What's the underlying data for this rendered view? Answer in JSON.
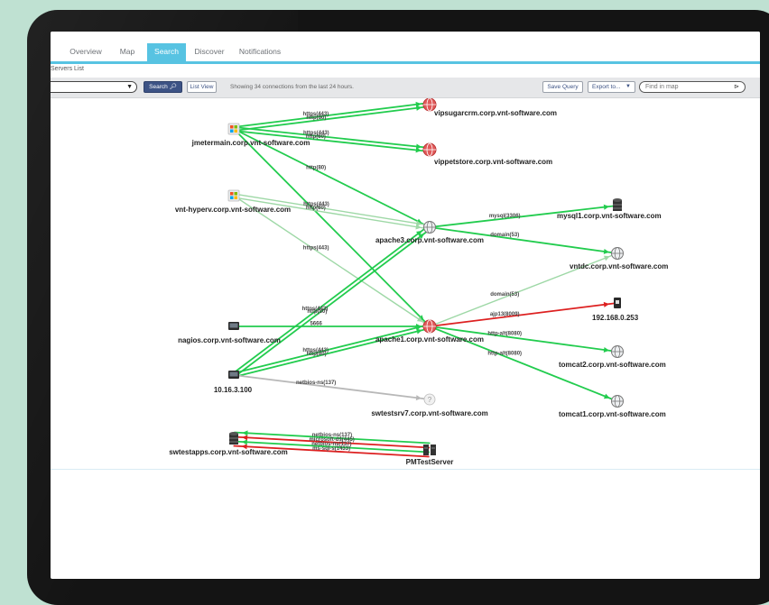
{
  "tabs": [
    {
      "label": "Overview"
    },
    {
      "label": "Map"
    },
    {
      "label": "Search"
    },
    {
      "label": "Discover"
    },
    {
      "label": "Notifications"
    }
  ],
  "breadcrumb": "Servers List",
  "toolbar": {
    "search_label": "Search",
    "list_view_label": "List View",
    "status_text": "Showing 34 connections from the last 24 hours.",
    "save_query_label": "Save Query",
    "export_label": "Export to...",
    "find_placeholder": "Find in map"
  },
  "colors": {
    "accent": "#57c3e2",
    "edge_green": "#22cc4e",
    "edge_light_green": "#9ed8a6",
    "edge_red": "#dd2020",
    "edge_gray": "#b8b8b8"
  },
  "nodes": [
    {
      "id": "jmeter",
      "label": "jmetermain.corp.vnt-software.com",
      "icon": "windows-server-icon"
    },
    {
      "id": "vipsugar",
      "label": "vipsugarcrm.corp.vnt-software.com",
      "icon": "red-globe-icon"
    },
    {
      "id": "vippet",
      "label": "vippetstore.corp.vnt-software.com",
      "icon": "red-globe-icon"
    },
    {
      "id": "hyperv",
      "label": "vnt-hyperv.corp.vnt-software.com",
      "icon": "windows-server-icon"
    },
    {
      "id": "apache3",
      "label": "apache3.corp.vnt-software.com",
      "icon": "web-server-icon"
    },
    {
      "id": "mysql1",
      "label": "mysql1.corp.vnt-software.com",
      "icon": "database-icon"
    },
    {
      "id": "vntdc",
      "label": "vntdc.corp.vnt-software.com",
      "icon": "globe-icon"
    },
    {
      "id": "ip253",
      "label": "192.168.0.253",
      "icon": "device-icon"
    },
    {
      "id": "nagios",
      "label": "nagios.corp.vnt-software.com",
      "icon": "monitor-icon"
    },
    {
      "id": "apache1",
      "label": "apache1.corp.vnt-software.com",
      "icon": "red-web-server-icon"
    },
    {
      "id": "tomcat2",
      "label": "tomcat2.corp.vnt-software.com",
      "icon": "globe-icon"
    },
    {
      "id": "ip100",
      "label": "10.16.3.100",
      "icon": "monitor-icon"
    },
    {
      "id": "swtestsrv7",
      "label": "swtestsrv7.corp.vnt-software.com",
      "icon": "unknown-host-icon"
    },
    {
      "id": "tomcat1",
      "label": "tomcat1.corp.vnt-software.com",
      "icon": "globe-icon"
    },
    {
      "id": "swtestapps",
      "label": "swtestapps.corp.vnt-software.com",
      "icon": "database-icon"
    },
    {
      "id": "pmtest",
      "label": "PMTestServer",
      "icon": "server-icon"
    }
  ],
  "edges": [
    {
      "from": "jmeter",
      "to": "vipsugar",
      "color": "green",
      "label": "https(443)"
    },
    {
      "from": "jmeter",
      "to": "vipsugar",
      "color": "green",
      "label": "http(80)"
    },
    {
      "from": "jmeter",
      "to": "vippet",
      "color": "green",
      "label": "https(443)"
    },
    {
      "from": "jmeter",
      "to": "vippet",
      "color": "green",
      "label": "http(80)"
    },
    {
      "from": "jmeter",
      "to": "apache3",
      "color": "green",
      "label": "http(80)"
    },
    {
      "from": "jmeter",
      "to": "apache1",
      "color": "green",
      "label": ""
    },
    {
      "from": "hyperv",
      "to": "apache3",
      "color": "light",
      "label": "https(443)"
    },
    {
      "from": "hyperv",
      "to": "apache3",
      "color": "light",
      "label": "http(80)"
    },
    {
      "from": "hyperv",
      "to": "apache1",
      "color": "light",
      "label": "https(443)"
    },
    {
      "from": "apache3",
      "to": "mysql1",
      "color": "green",
      "label": "mysql(3306)"
    },
    {
      "from": "apache3",
      "to": "vntdc",
      "color": "green",
      "label": "domain(53)"
    },
    {
      "from": "apache1",
      "to": "vntdc",
      "color": "light",
      "label": "domain(53)"
    },
    {
      "from": "apache1",
      "to": "ip253",
      "color": "red",
      "label": "ajp13(8009)"
    },
    {
      "from": "apache1",
      "to": "tomcat2",
      "color": "green",
      "label": "http-alt(8080)"
    },
    {
      "from": "apache1",
      "to": "tomcat1",
      "color": "green",
      "label": "http-alt(8080)"
    },
    {
      "from": "nagios",
      "to": "apache1",
      "color": "green",
      "label": "5666"
    },
    {
      "from": "ip100",
      "to": "apache3",
      "color": "green",
      "label": "https(443)"
    },
    {
      "from": "ip100",
      "to": "apache3",
      "color": "green",
      "label": "http(80)"
    },
    {
      "from": "ip100",
      "to": "apache1",
      "color": "green",
      "label": "https(443)"
    },
    {
      "from": "ip100",
      "to": "apache1",
      "color": "green",
      "label": "http(80)"
    },
    {
      "from": "ip100",
      "to": "swtestsrv7",
      "color": "gray",
      "label": "netbios-ns(137)"
    },
    {
      "from": "pmtest",
      "to": "swtestapps",
      "color": "red",
      "label": "ms-sql-s(1433)"
    },
    {
      "from": "pmtest",
      "to": "swtestapps",
      "color": "green",
      "label": "netbios-ns(137)"
    },
    {
      "from": "pmtest",
      "to": "swtestapps",
      "color": "red",
      "label": "microsoft-ds(445)"
    },
    {
      "from": "pmtest",
      "to": "swtestapps",
      "color": "green",
      "label": "netbios-ns(137)"
    }
  ]
}
